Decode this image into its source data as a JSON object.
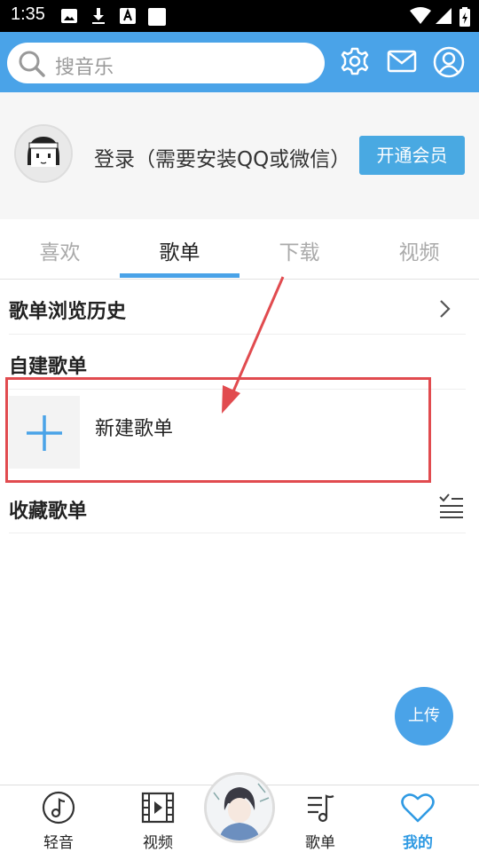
{
  "status_bar": {
    "time": "1:35"
  },
  "search": {
    "placeholder": "搜音乐"
  },
  "profile": {
    "login_text": "登录（需要安装QQ或微信）",
    "vip_button": "开通会员"
  },
  "tabs": [
    {
      "label": "喜欢"
    },
    {
      "label": "歌单",
      "active": true
    },
    {
      "label": "下载"
    },
    {
      "label": "视频"
    }
  ],
  "sections": {
    "history": "歌单浏览历史",
    "self_created": "自建歌单",
    "new_playlist": "新建歌单",
    "collected": "收藏歌单"
  },
  "fab": {
    "label": "上传"
  },
  "bottom_nav": [
    {
      "label": "轻音",
      "icon": "music-note-icon"
    },
    {
      "label": "视频",
      "icon": "film-icon"
    },
    {
      "label": "歌单",
      "icon": "playlist-icon"
    },
    {
      "label": "我的",
      "icon": "heart-icon",
      "active": true
    }
  ],
  "colors": {
    "accent": "#4aa3e8",
    "highlight_box": "#e14b4f"
  }
}
